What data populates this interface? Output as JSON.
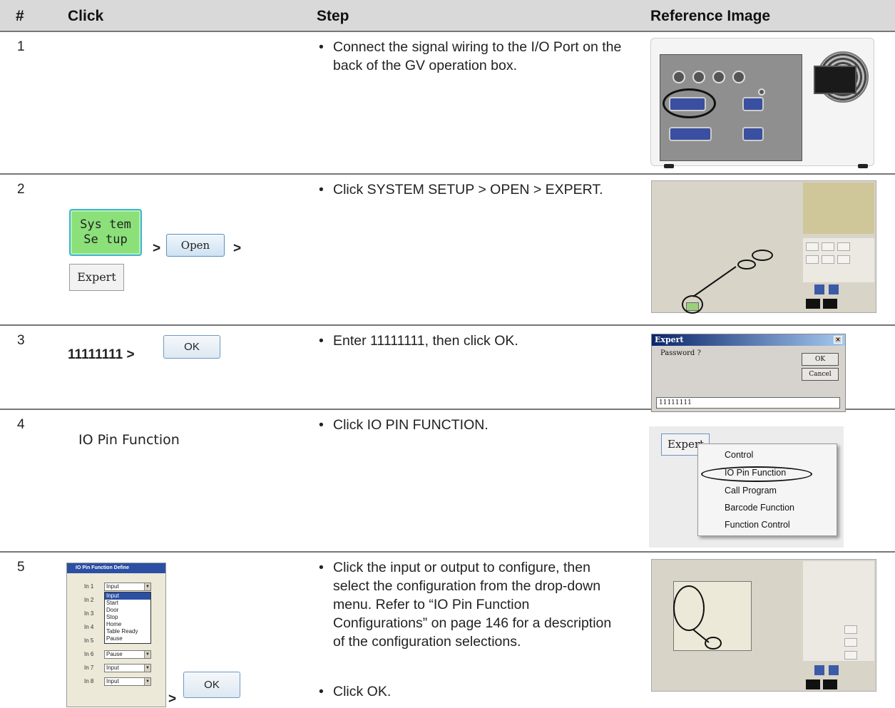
{
  "table": {
    "headers": {
      "num": "#",
      "click": "Click",
      "step": "Step",
      "ref": "Reference Image"
    },
    "rows": [
      {
        "num": "1",
        "bullets": [
          "Connect the signal wiring to the I/O Port on the back of the GV operation box."
        ]
      },
      {
        "num": "2",
        "click": {
          "system_setup": "Sys tem\nSe tup",
          "open": "Open",
          "expert": "Expert",
          "gt": ">"
        },
        "bullets": [
          "Click SYSTEM SETUP > OPEN > EXPERT."
        ]
      },
      {
        "num": "3",
        "click": {
          "value": "11111111 >",
          "ok": "OK"
        },
        "bullets": [
          "Enter 11111111, then click OK."
        ],
        "ref": {
          "title": "Expert",
          "close": "×",
          "prompt": "Password ?",
          "ok": "OK",
          "cancel": "Cancel",
          "input": "11111111"
        }
      },
      {
        "num": "4",
        "click": {
          "label": "IO Pin Function"
        },
        "bullets": [
          "Click IO PIN FUNCTION."
        ],
        "ref": {
          "button": "Expert",
          "menu": [
            "Control",
            "IO Pin Function",
            "Call Program",
            "Barcode Function",
            "Function Control"
          ]
        }
      },
      {
        "num": "5",
        "click": {
          "dialog_title": "IO Pin Function Define",
          "pins": [
            "In 1",
            "In 2",
            "In 3",
            "In 4",
            "In 5",
            "In 6",
            "In 7",
            "In 8"
          ],
          "selected_in1": "Input",
          "options": [
            "Input",
            "Start",
            "Door",
            "Stop",
            "Home",
            "Table Ready",
            "Pause"
          ],
          "in6": "Pause",
          "in7": "Input",
          "in8": "Input",
          "gt": ">",
          "ok": "OK"
        },
        "bullets": [
          "Click the input or output to configure, then select the configuration from the drop-down menu. Refer to “IO Pin Function Configurations” on page 146 for a description of the configuration selections.",
          "Click OK."
        ]
      }
    ]
  }
}
